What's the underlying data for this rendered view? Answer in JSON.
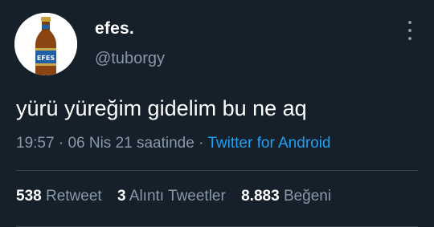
{
  "user": {
    "display_name": "efes.",
    "handle": "@tuborgy",
    "avatar_icon": "efes-beer-bottle-icon",
    "avatar_label": "EFES"
  },
  "tweet": {
    "text": "yürü yüreğim gidelim bu ne aq",
    "time": "19:57",
    "sep1": " · ",
    "date": "06 Nis 21 saatinde",
    "sep2": " · ",
    "source": "Twitter for Android"
  },
  "stats": [
    {
      "count": "538",
      "label": "Retweet"
    },
    {
      "count": "3",
      "label": "Alıntı Tweetler"
    },
    {
      "count": "8.883",
      "label": "Beğeni"
    }
  ],
  "colors": {
    "background": "#15202b",
    "text": "#ffffff",
    "muted": "#8899a6",
    "accent": "#1da1f2",
    "divider": "#38444d"
  }
}
